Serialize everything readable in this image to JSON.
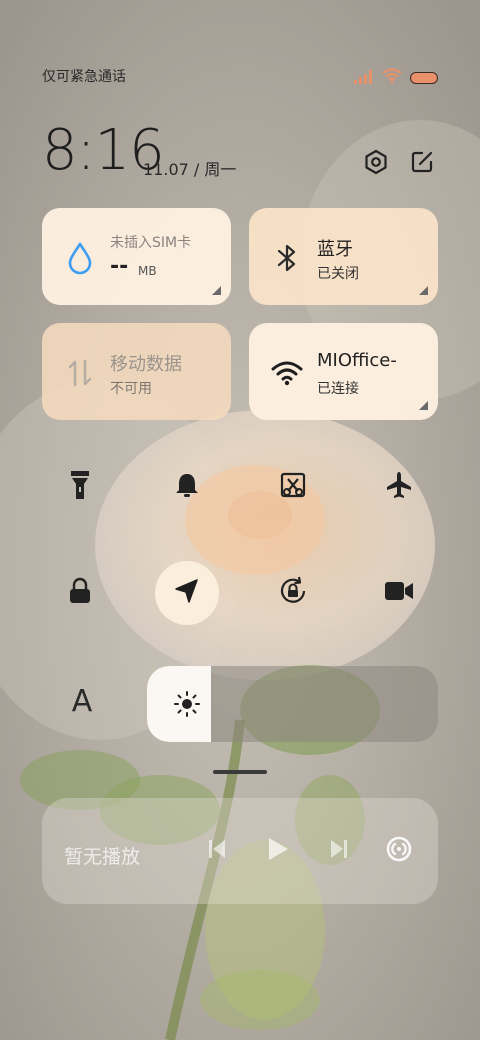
{
  "status": {
    "carrier": "仅可紧急通话",
    "signal_icon": "signal-icon",
    "wifi_icon": "wifi-icon",
    "battery_icon": "battery-icon",
    "accent": "#e8916a"
  },
  "header": {
    "time": "8:16",
    "date": "11.07 / 周一",
    "settings_icon": "settings-icon",
    "edit_icon": "edit-icon"
  },
  "tiles": {
    "data_usage": {
      "title": "未插入SIM卡",
      "value": "--",
      "unit": "MB",
      "icon": "droplet-icon",
      "accent": "#3d9df0"
    },
    "bluetooth": {
      "title": "蓝牙",
      "status": "已关闭",
      "icon": "bluetooth-icon"
    },
    "mobile_data": {
      "title": "移动数据",
      "status": "不可用",
      "icon": "mobile-data-icon"
    },
    "wifi": {
      "title": "MIOffice-",
      "status": "已连接",
      "icon": "wifi-icon"
    }
  },
  "toggles": [
    {
      "name": "flashlight",
      "icon": "flashlight-icon",
      "active": false
    },
    {
      "name": "mute",
      "icon": "bell-icon",
      "active": false
    },
    {
      "name": "screenshot",
      "icon": "screenshot-icon",
      "active": false
    },
    {
      "name": "airplane",
      "icon": "airplane-icon",
      "active": false
    },
    {
      "name": "lock",
      "icon": "lock-icon",
      "active": false
    },
    {
      "name": "location",
      "icon": "location-icon",
      "active": true
    },
    {
      "name": "rotation-lock",
      "icon": "rotation-lock-icon",
      "active": false
    },
    {
      "name": "screen-record",
      "icon": "video-camera-icon",
      "active": false
    }
  ],
  "display": {
    "font_label": "A",
    "brightness_level": 0.22,
    "brightness_icon": "sun-icon"
  },
  "media": {
    "label": "暂无播放",
    "prev_icon": "skip-previous-icon",
    "play_icon": "play-icon",
    "next_icon": "skip-next-icon",
    "cast_icon": "cast-icon"
  }
}
